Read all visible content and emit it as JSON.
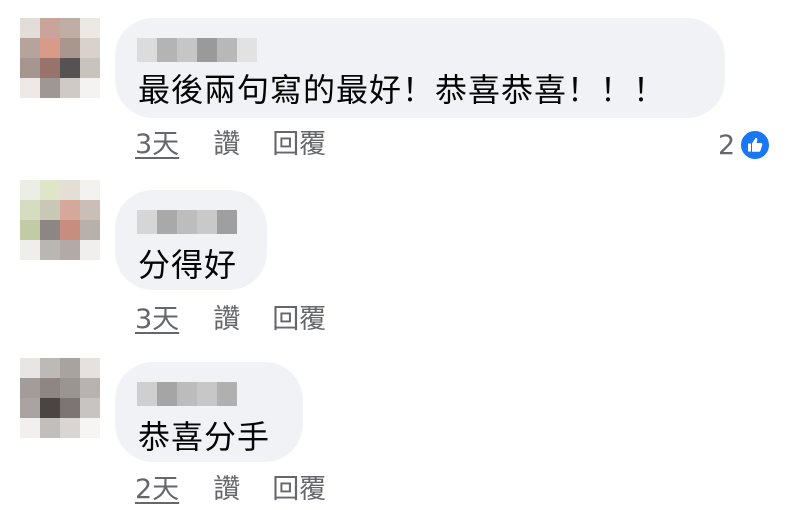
{
  "comments": [
    {
      "text": "最後兩句寫的最好！恭喜恭喜！！！",
      "time": "3天",
      "like_label": "讚",
      "reply_label": "回覆",
      "reaction_count": "2",
      "reaction_icon": "like-icon"
    },
    {
      "text": "分得好",
      "time": "3天",
      "like_label": "讚",
      "reply_label": "回覆"
    },
    {
      "text": "恭喜分手",
      "time": "2天",
      "like_label": "讚",
      "reply_label": "回覆"
    }
  ],
  "colors": {
    "bubble": "#f0f2f5",
    "meta_text": "#65676b",
    "like_blue": "#1877f2"
  }
}
